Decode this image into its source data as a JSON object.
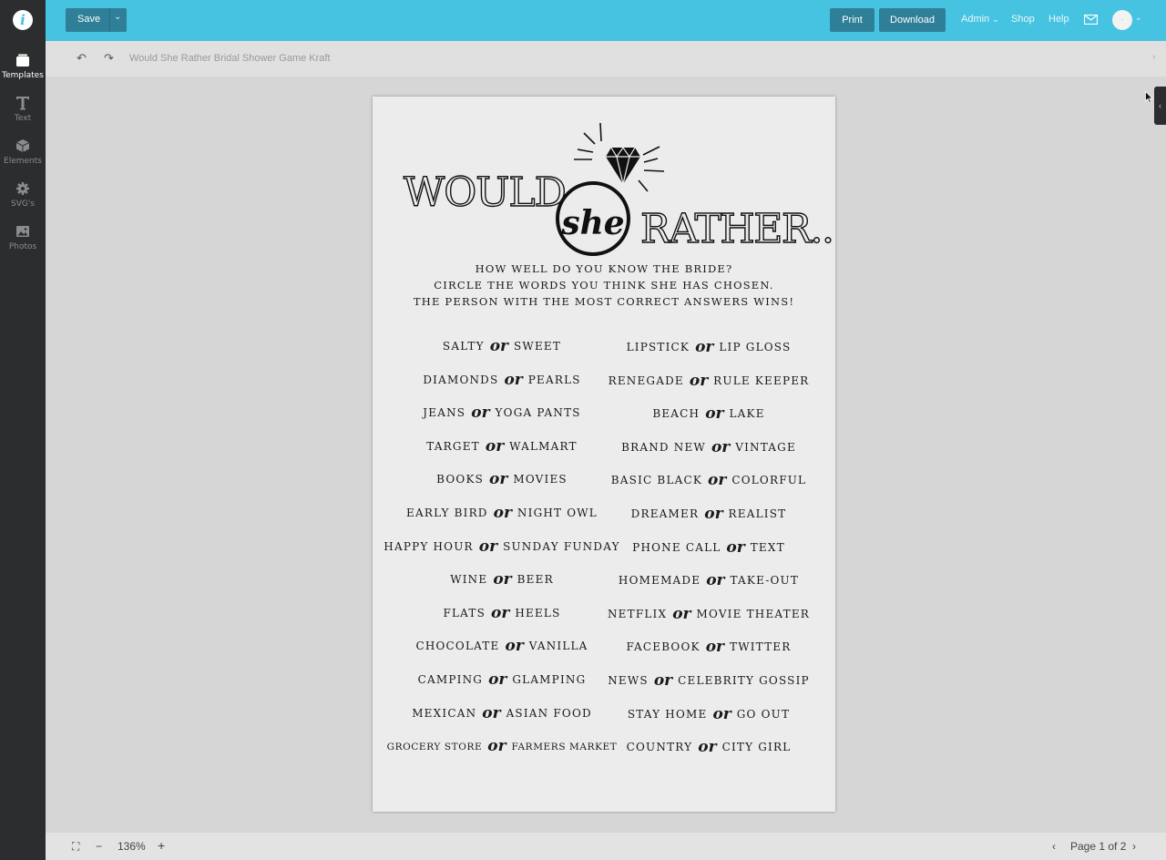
{
  "rail": {
    "items": [
      {
        "label": "Templates",
        "icon": "templates-icon"
      },
      {
        "label": "Text",
        "icon": "text-icon"
      },
      {
        "label": "Elements",
        "icon": "elements-icon"
      },
      {
        "label": "SVG's",
        "icon": "gear-icon"
      },
      {
        "label": "Photos",
        "icon": "photos-icon"
      }
    ]
  },
  "topbar": {
    "save_label": "Save",
    "print_label": "Print",
    "download_label": "Download",
    "admin_label": "Admin",
    "shop_label": "Shop",
    "help_label": "Help",
    "accent": "#47c3e2"
  },
  "subbar": {
    "doc_title": "Would She Rather Bridal Shower Game Kraft"
  },
  "document": {
    "title_would": "WOULD",
    "title_she": "she",
    "title_rather": "RATHER...",
    "intro": [
      "HOW WELL DO YOU KNOW THE BRIDE?",
      "CIRCLE THE WORDS YOU THINK SHE HAS CHOSEN.",
      "THE PERSON WITH THE MOST CORRECT ANSWERS WINS!"
    ],
    "or_word": "or",
    "left": [
      {
        "a": "SALTY",
        "b": "SWEET"
      },
      {
        "a": "DIAMONDS",
        "b": "PEARLS"
      },
      {
        "a": "JEANS",
        "b": "YOGA PANTS"
      },
      {
        "a": "TARGET",
        "b": "WALMART"
      },
      {
        "a": "BOOKS",
        "b": "MOVIES"
      },
      {
        "a": "EARLY BIRD",
        "b": "NIGHT OWL"
      },
      {
        "a": "HAPPY HOUR",
        "b": "SUNDAY FUNDAY"
      },
      {
        "a": "WINE",
        "b": "BEER"
      },
      {
        "a": "FLATS",
        "b": "HEELS"
      },
      {
        "a": "CHOCOLATE",
        "b": "VANILLA"
      },
      {
        "a": "CAMPING",
        "b": "GLAMPING"
      },
      {
        "a": "MEXICAN",
        "b": "ASIAN FOOD"
      },
      {
        "a": "GROCERY STORE",
        "b": "FARMERS MARKET"
      }
    ],
    "right": [
      {
        "a": "LIPSTICK",
        "b": "LIP GLOSS"
      },
      {
        "a": "RENEGADE",
        "b": "RULE KEEPER"
      },
      {
        "a": "BEACH",
        "b": "LAKE"
      },
      {
        "a": "BRAND NEW",
        "b": "VINTAGE"
      },
      {
        "a": "BASIC BLACK",
        "b": "COLORFUL"
      },
      {
        "a": "DREAMER",
        "b": "REALIST"
      },
      {
        "a": "PHONE CALL",
        "b": "TEXT"
      },
      {
        "a": "HOMEMADE",
        "b": "TAKE-OUT"
      },
      {
        "a": "NETFLIX",
        "b": "MOVIE THEATER"
      },
      {
        "a": "FACEBOOK",
        "b": "TWITTER"
      },
      {
        "a": "NEWS",
        "b": "CELEBRITY GOSSIP"
      },
      {
        "a": "STAY HOME",
        "b": "GO OUT"
      },
      {
        "a": "COUNTRY",
        "b": "CITY GIRL"
      }
    ]
  },
  "bottombar": {
    "zoom": "136%",
    "page_label": "Page 1 of 2"
  }
}
